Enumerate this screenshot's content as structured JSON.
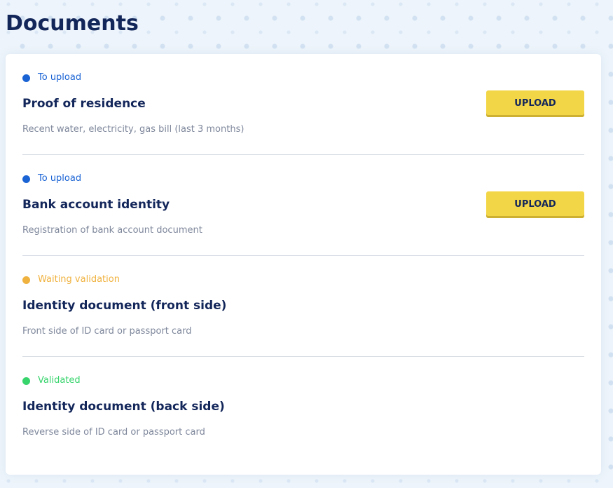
{
  "page": {
    "title": "Documents"
  },
  "documents": [
    {
      "status": "To upload",
      "status_color": "#1a63d4",
      "title": "Proof of residence",
      "description": "Recent water, electricity, gas bill (last 3 months)",
      "action_label": "UPLOAD"
    },
    {
      "status": "To upload",
      "status_color": "#1a63d4",
      "title": "Bank account identity",
      "description": "Registration of bank account document",
      "action_label": "UPLOAD"
    },
    {
      "status": "Waiting validation",
      "status_color": "#f0b23f",
      "title": "Identity document (front side)",
      "description": "Front side of ID card or passport card"
    },
    {
      "status": "Validated",
      "status_color": "#37d46c",
      "title": "Identity document (back side)",
      "description": "Reverse side of ID card or passport card"
    }
  ],
  "colors": {
    "heading": "#13265a",
    "description": "#7e879b",
    "upload_button": "#f3d647",
    "divider": "#d8dde5",
    "background": "#edf4fb"
  }
}
